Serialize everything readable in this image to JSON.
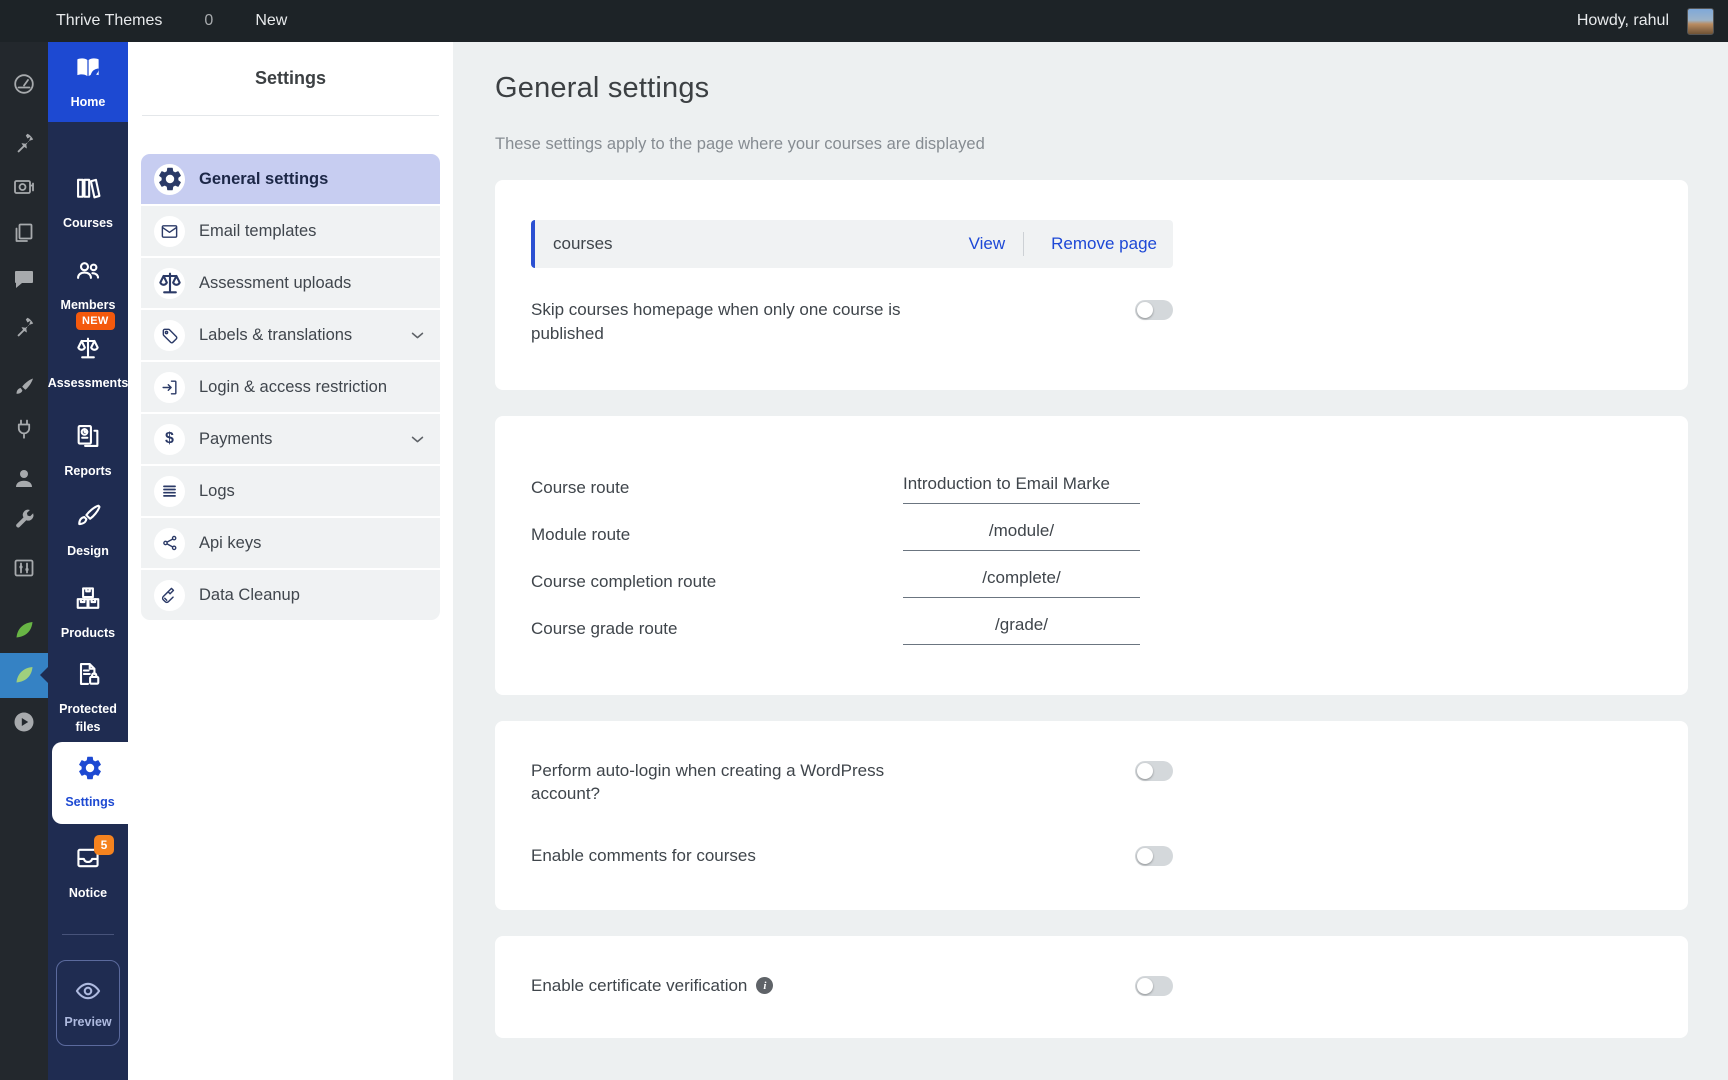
{
  "admin_bar": {
    "site_name": "Thrive Themes",
    "comment_count": "0",
    "new_label": "New",
    "greeting": "Howdy, rahul"
  },
  "wp_sidebar": {
    "icons": [
      "dashboard-icon",
      "pin-icon",
      "media-icon",
      "pages-icon",
      "comments-icon",
      "pin-icon",
      "brush-icon",
      "plugin-icon",
      "users-icon",
      "wrench-icon",
      "sliders-icon",
      "leaf-icon",
      "leaf-icon",
      "play-icon"
    ]
  },
  "sidebar": {
    "items": [
      {
        "label": "Home",
        "icon": "book-leaf-icon",
        "state": "active-blue"
      },
      {
        "label": "Courses",
        "icon": "library-icon"
      },
      {
        "label": "Members",
        "icon": "members-icon"
      },
      {
        "label": "Assessments",
        "icon": "scale-icon",
        "badge": "NEW"
      },
      {
        "label": "Reports",
        "icon": "report-icon"
      },
      {
        "label": "Design",
        "icon": "design-brush-icon"
      },
      {
        "label": "Products",
        "icon": "products-icon"
      },
      {
        "label": "Protected files",
        "icon": "protected-file-icon"
      },
      {
        "label": "Settings",
        "icon": "gear-icon",
        "state": "active-white"
      },
      {
        "label": "Notice",
        "icon": "notice-icon",
        "badge": "5"
      }
    ],
    "preview_label": "Preview"
  },
  "settings_menu": {
    "title": "Settings",
    "items": [
      {
        "label": "General settings",
        "icon": "gear-icon",
        "active": true
      },
      {
        "label": "Email templates",
        "icon": "envelope-icon"
      },
      {
        "label": "Assessment uploads",
        "icon": "scale-icon"
      },
      {
        "label": "Labels & translations",
        "icon": "tag-icon",
        "expandable": true
      },
      {
        "label": "Login & access restriction",
        "icon": "login-icon"
      },
      {
        "label": "Payments",
        "icon": "dollar-icon",
        "expandable": true
      },
      {
        "label": "Logs",
        "icon": "list-icon"
      },
      {
        "label": "Api keys",
        "icon": "api-icon"
      },
      {
        "label": "Data Cleanup",
        "icon": "broom-icon"
      }
    ]
  },
  "main": {
    "title": "General settings",
    "subtitle": "These settings apply to the page where your courses are displayed",
    "index_page": {
      "page_name": "courses",
      "view_label": "View",
      "remove_label": "Remove page"
    },
    "skip_homepage": {
      "label": "Skip courses homepage when only one course is published",
      "on": false
    },
    "routes": [
      {
        "label": "Course route",
        "value": "Introduction to Email Marke"
      },
      {
        "label": "Module route",
        "value": "/module/"
      },
      {
        "label": "Course completion route",
        "value": "/complete/"
      },
      {
        "label": "Course grade route",
        "value": "/grade/"
      }
    ],
    "auto_login": {
      "label": "Perform auto-login when creating a WordPress account?",
      "on": false
    },
    "enable_comments": {
      "label": "Enable comments for courses",
      "on": false
    },
    "certificate": {
      "label": "Enable certificate verification",
      "on": false
    }
  },
  "colors": {
    "accent_blue": "#1d49d2",
    "link_blue": "#1d48d6",
    "sidebar_navy": "#1f2c51",
    "new_badge": "#f4590d",
    "notice_badge": "#f5831f",
    "active_menu_bg": "#c7cdf1"
  }
}
